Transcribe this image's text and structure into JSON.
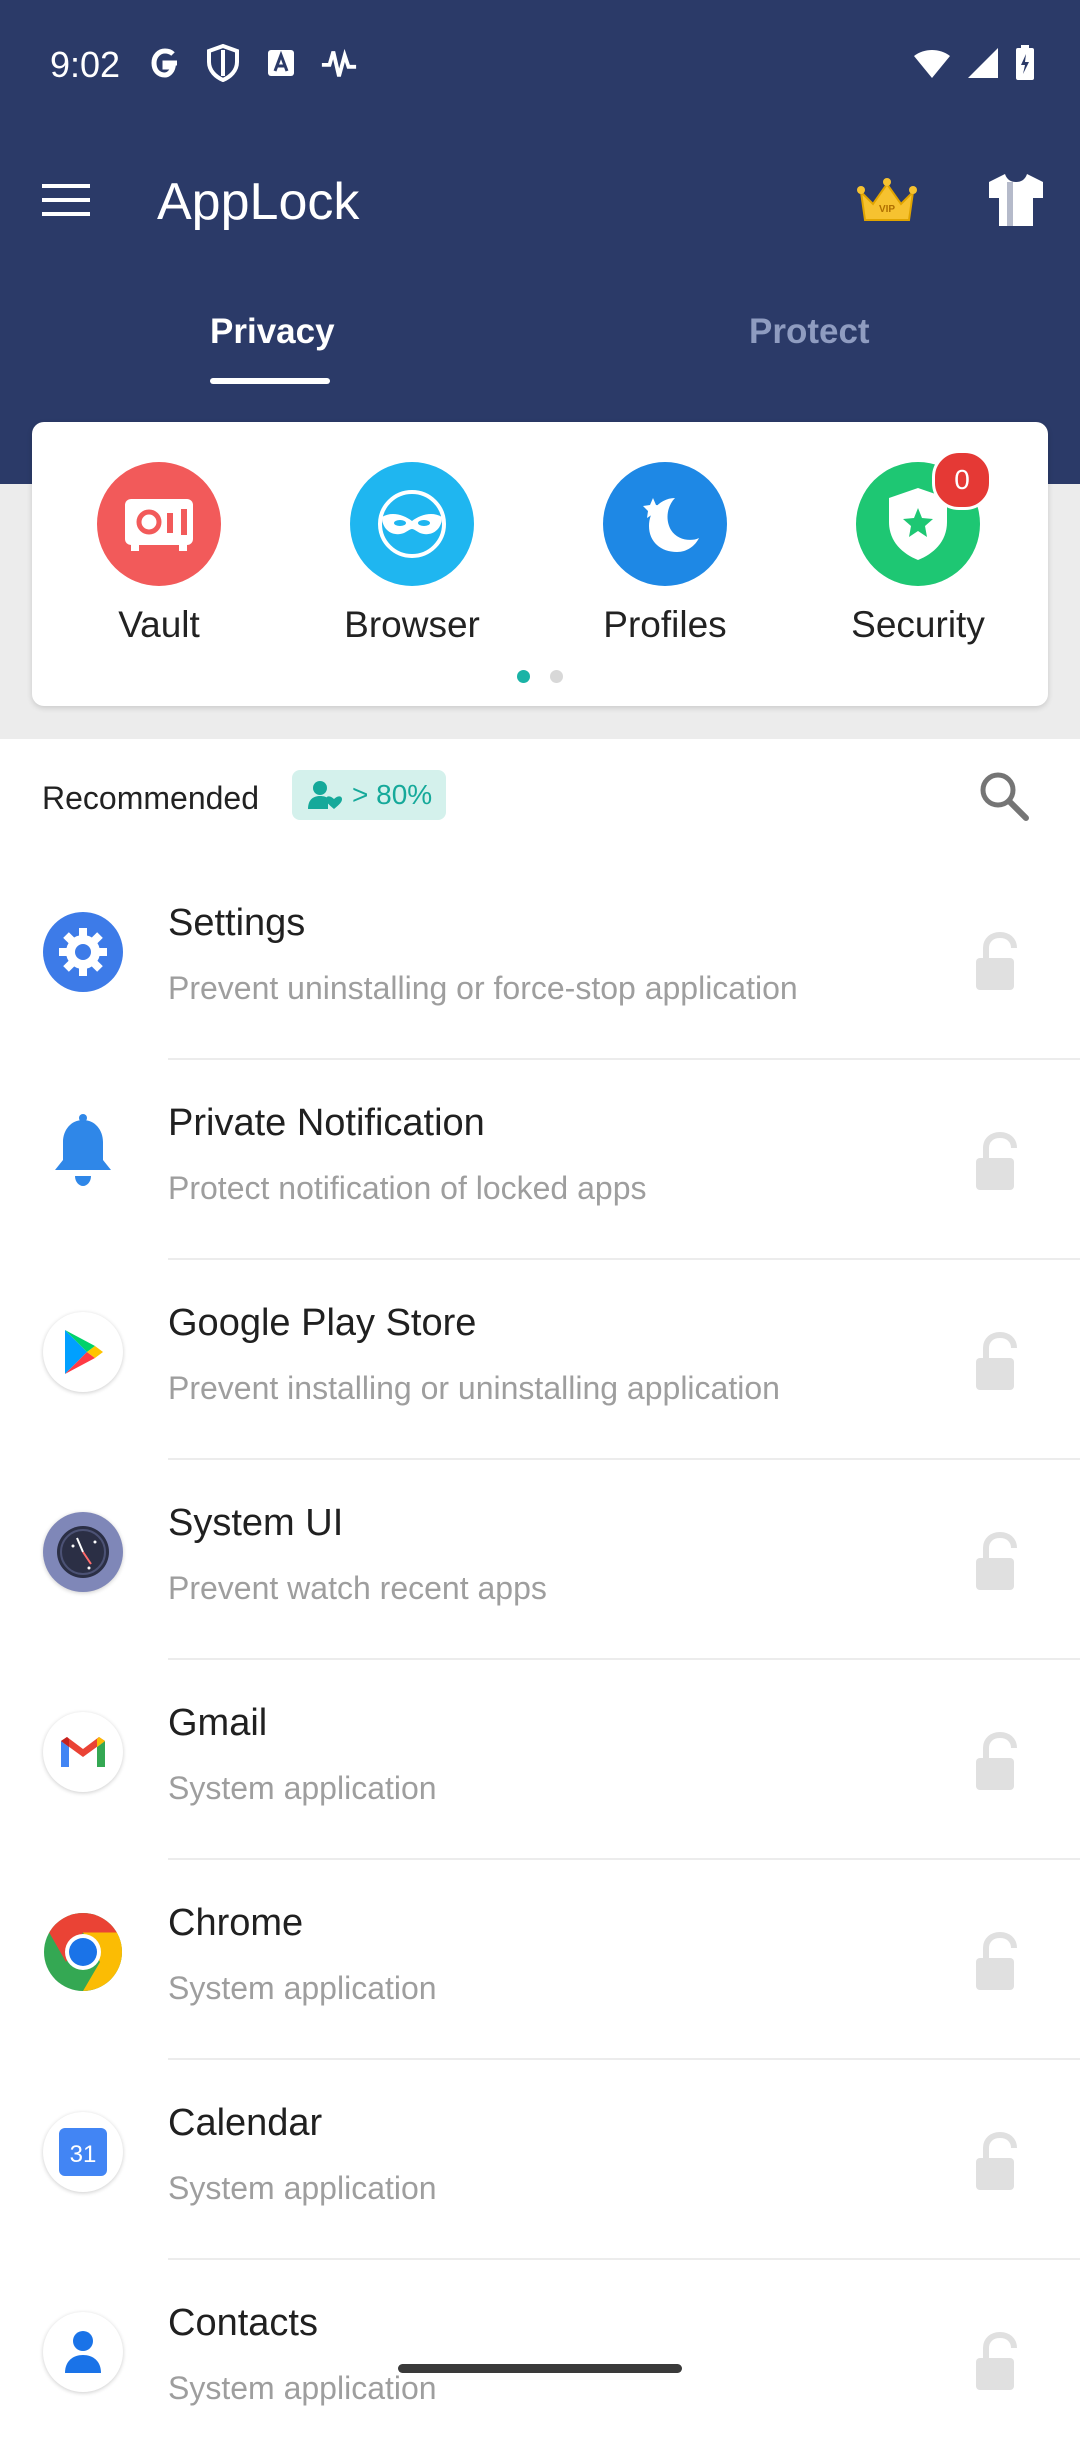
{
  "status_bar": {
    "time": "9:02"
  },
  "app_bar": {
    "title": "AppLock"
  },
  "tabs": [
    {
      "label": "Privacy",
      "selected": true
    },
    {
      "label": "Protect",
      "selected": false
    }
  ],
  "features": [
    {
      "label": "Vault",
      "icon": "vault-icon",
      "color": "#f25a5a"
    },
    {
      "label": "Browser",
      "icon": "mask-icon",
      "color": "#1fb6f0"
    },
    {
      "label": "Profiles",
      "icon": "moon-icon",
      "color": "#1e88e5"
    },
    {
      "label": "Security",
      "icon": "shield-star-icon",
      "color": "#1ec773",
      "badge": "0"
    }
  ],
  "recommended": {
    "label": "Recommended",
    "badge": "> 80%"
  },
  "apps": [
    {
      "title": "Settings",
      "subtitle": "Prevent uninstalling or force-stop application",
      "icon": "settings-gear-icon"
    },
    {
      "title": "Private Notification",
      "subtitle": "Protect notification of locked apps",
      "icon": "bell-icon"
    },
    {
      "title": "Google Play Store",
      "subtitle": "Prevent installing or uninstalling application",
      "icon": "play-store-icon"
    },
    {
      "title": "System UI",
      "subtitle": "Prevent watch recent apps",
      "icon": "system-ui-icon"
    },
    {
      "title": "Gmail",
      "subtitle": "System application",
      "icon": "gmail-icon"
    },
    {
      "title": "Chrome",
      "subtitle": "System application",
      "icon": "chrome-icon"
    },
    {
      "title": "Calendar",
      "subtitle": "System application",
      "icon": "calendar-icon",
      "day": "31"
    },
    {
      "title": "Contacts",
      "subtitle": "System application",
      "icon": "contacts-icon"
    }
  ]
}
